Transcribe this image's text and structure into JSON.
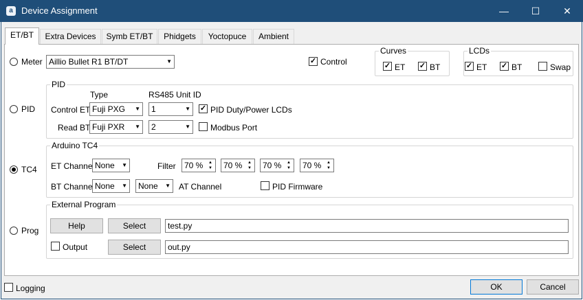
{
  "window": {
    "title": "Device Assignment",
    "app_icon": "a",
    "minimize": "—",
    "maximize": "☐",
    "close": "✕"
  },
  "tabs": [
    "ET/BT",
    "Extra Devices",
    "Symb ET/BT",
    "Phidgets",
    "Yoctopuce",
    "Ambient"
  ],
  "meter": {
    "label": "Meter",
    "device": "Aillio Bullet R1 BT/DT",
    "control_label": "Control",
    "control_checked": true
  },
  "curves": {
    "title": "Curves",
    "et": "ET",
    "bt": "BT",
    "et_checked": true,
    "bt_checked": true
  },
  "lcds": {
    "title": "LCDs",
    "et": "ET",
    "bt": "BT",
    "swap": "Swap",
    "et_checked": true,
    "bt_checked": true,
    "swap_checked": false
  },
  "pid": {
    "radio_label": "PID",
    "group_title": "PID",
    "type_header": "Type",
    "unit_header": "RS485 Unit ID",
    "control_label": "Control ET",
    "control_type": "Fuji PXG",
    "control_unit": "1",
    "read_label": "Read BT",
    "read_type": "Fuji PXR",
    "read_unit": "2",
    "duty_lcds": "PID Duty/Power LCDs",
    "duty_checked": true,
    "modbus_port": "Modbus Port",
    "modbus_checked": false
  },
  "tc4": {
    "radio_label": "TC4",
    "group_title": "Arduino TC4",
    "et_channel_label": "ET Channel",
    "et_channel": "None",
    "filter_label": "Filter",
    "filters": [
      "70 %",
      "70 %",
      "70 %",
      "70 %"
    ],
    "bt_channel_label": "BT Channel",
    "bt_channel": "None",
    "at_channel": "None",
    "at_channel_label": "AT Channel",
    "pid_firmware": "PID Firmware",
    "pid_firmware_checked": false
  },
  "prog": {
    "radio_label": "Prog",
    "group_title": "External Program",
    "help_button": "Help",
    "select_button": "Select",
    "program": "test.py",
    "output_label": "Output",
    "output_checked": false,
    "output_select_button": "Select",
    "output_file": "out.py"
  },
  "selected_source": "TC4",
  "footer": {
    "logging": "Logging",
    "logging_checked": false,
    "ok": "OK",
    "cancel": "Cancel"
  }
}
